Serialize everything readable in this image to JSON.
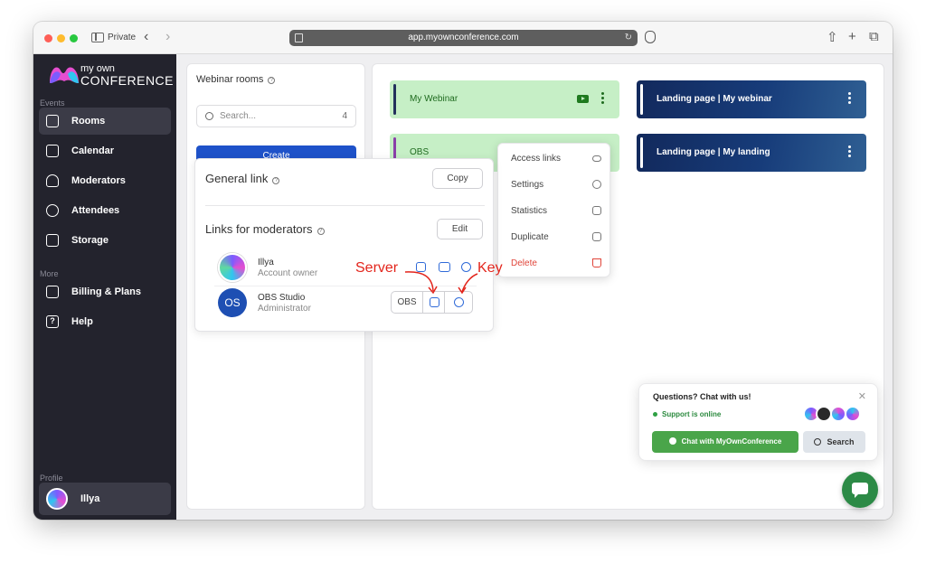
{
  "browser": {
    "private_label": "Private",
    "url": "app.myownconference.com",
    "back_icon": "chevron-left-icon",
    "forward_icon": "chevron-right-icon"
  },
  "brand": {
    "line1": "my own",
    "line2": "CONFERENCE",
    "colors": [
      "#7b5cff",
      "#e54ed0",
      "#2fc6f0"
    ]
  },
  "sidebar": {
    "events_label": "Events",
    "more_label": "More",
    "profile_label": "Profile",
    "items": [
      {
        "label": "Rooms",
        "icon": "cast-icon",
        "active": true
      },
      {
        "label": "Calendar",
        "icon": "calendar-icon"
      },
      {
        "label": "Moderators",
        "icon": "user-icon"
      },
      {
        "label": "Attendees",
        "icon": "users-icon"
      },
      {
        "label": "Storage",
        "icon": "folder-icon"
      }
    ],
    "more_items": [
      {
        "label": "Billing & Plans",
        "icon": "card-icon"
      },
      {
        "label": "Help",
        "icon": "help-icon"
      }
    ],
    "profile_name": "Illya"
  },
  "rooms_panel": {
    "title": "Webinar rooms",
    "search_placeholder": "Search...",
    "count": "4",
    "create_label": "Create"
  },
  "rooms": [
    {
      "name": "My Webinar",
      "style": "green",
      "accent": "#23305c"
    },
    {
      "name": "Landing page  |  My webinar",
      "style": "dark",
      "accent": "#ffffff"
    },
    {
      "name": "OBS",
      "style": "green",
      "accent": "#8a3fa8"
    },
    {
      "name": "Landing page  |  My landing",
      "style": "dark",
      "accent": "#ffffff"
    }
  ],
  "context_menu": {
    "items": [
      {
        "label": "Access links",
        "icon": "link-icon"
      },
      {
        "label": "Settings",
        "icon": "gear-icon"
      },
      {
        "label": "Statistics",
        "icon": "chart-icon"
      },
      {
        "label": "Duplicate",
        "icon": "copy-icon"
      },
      {
        "label": "Delete",
        "icon": "trash-icon",
        "danger": true
      }
    ]
  },
  "links_panel": {
    "general_title": "General link",
    "copy_label": "Copy",
    "moderators_title": "Links for moderators",
    "edit_label": "Edit",
    "moderators": [
      {
        "name": "Illya",
        "role": "Account owner"
      },
      {
        "name": "OBS Studio",
        "role": "Administrator",
        "initials": "OS",
        "tag": "OBS"
      }
    ]
  },
  "annotations": {
    "server": "Server",
    "key": "Key",
    "color": "#e3251c"
  },
  "chat_widget": {
    "title": "Questions? Chat with us!",
    "status": "Support is online",
    "chat_button": "Chat with MyOwnConference",
    "search_button": "Search",
    "close_icon": "close-icon",
    "accent": "#4aa54a"
  }
}
